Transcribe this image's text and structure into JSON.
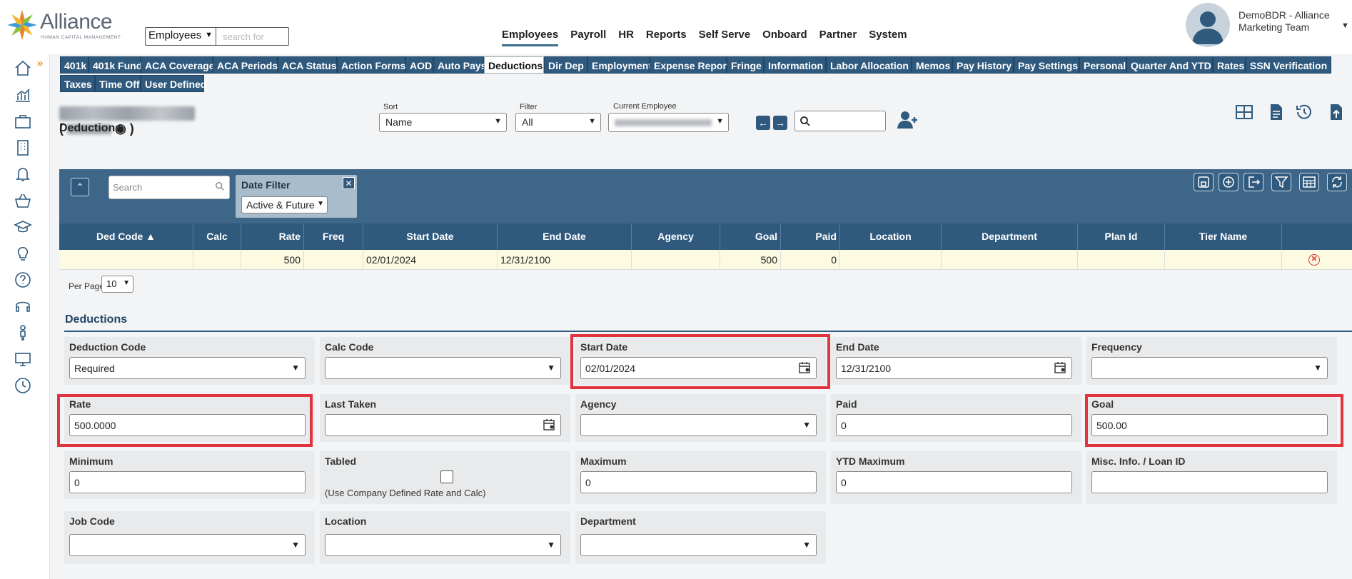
{
  "header": {
    "brand": "Alliance",
    "brand_tag": "HUMAN CAPITAL MANAGEMENT",
    "entity_select": "Employees",
    "search_placeholder": "search for",
    "nav": [
      "Employees",
      "Payroll",
      "HR",
      "Reports",
      "Self Serve",
      "Onboard",
      "Partner",
      "System"
    ],
    "active_nav": "Employees",
    "user_line1": "DemoBDR - Alliance",
    "user_line2": "Marketing Team"
  },
  "sidebar": {
    "icons": [
      "home-icon",
      "analytics-icon",
      "briefcase-icon",
      "building-icon",
      "bell-icon",
      "basket-icon",
      "graduation-cap-icon",
      "lightbulb-icon",
      "help-icon",
      "headset-icon",
      "person-icon",
      "monitor-icon",
      "clock-icon"
    ]
  },
  "tabs": {
    "row1": [
      "401k",
      "401k Fund",
      "ACA Coverage",
      "ACA Periods",
      "ACA Status",
      "Action Forms",
      "AOD",
      "Auto Pays",
      "Deductions",
      "Dir Dep",
      "Employment",
      "Expense Report",
      "Fringe",
      "Information",
      "Labor Allocation",
      "Memos",
      "Pay History",
      "Pay Settings",
      "Personal",
      "Quarter And YTD",
      "Rates",
      "SSN Verification"
    ],
    "row2": [
      "Taxes",
      "Time Off",
      "User Defined"
    ],
    "active": "Deductions"
  },
  "employee_bar": {
    "id_open": "(",
    "id_close": ")",
    "sort_label": "Sort",
    "sort_value": "Name",
    "filter_label": "Filter",
    "filter_value": "All",
    "current_label": "Current Employee"
  },
  "section_title": "Deductions",
  "grid": {
    "search_placeholder": "Search",
    "date_filter_label": "Date Filter",
    "date_filter_value": "Active & Future",
    "columns": [
      "Ded Code ▲",
      "Calc",
      "Rate",
      "Freq",
      "Start Date",
      "End Date",
      "Agency",
      "Goal",
      "Paid",
      "Location",
      "Department",
      "Plan Id",
      "Tier Name"
    ],
    "row": [
      "",
      "",
      "500",
      "",
      "02/01/2024",
      "12/31/2100",
      "",
      "500",
      "0",
      "",
      "",
      "",
      ""
    ],
    "per_page_label": "Per Page",
    "per_page_value": "10"
  },
  "form": {
    "title": "Deductions",
    "fields": {
      "deduction_code": {
        "label": "Deduction Code",
        "value": "Required"
      },
      "calc_code": {
        "label": "Calc Code",
        "value": ""
      },
      "start_date": {
        "label": "Start Date",
        "value": "02/01/2024"
      },
      "end_date": {
        "label": "End Date",
        "value": "12/31/2100"
      },
      "frequency": {
        "label": "Frequency",
        "value": ""
      },
      "rate": {
        "label": "Rate",
        "value": "500.0000"
      },
      "last_taken": {
        "label": "Last Taken",
        "value": ""
      },
      "agency": {
        "label": "Agency",
        "value": ""
      },
      "paid": {
        "label": "Paid",
        "value": "0"
      },
      "goal": {
        "label": "Goal",
        "value": "500.00"
      },
      "minimum": {
        "label": "Minimum",
        "value": "0"
      },
      "tabled": {
        "label": "Tabled",
        "note": "(Use Company Defined Rate and Calc)"
      },
      "maximum": {
        "label": "Maximum",
        "value": "0"
      },
      "ytd_maximum": {
        "label": "YTD Maximum",
        "value": "0"
      },
      "misc_info": {
        "label": "Misc. Info. / Loan ID",
        "value": ""
      },
      "job_code": {
        "label": "Job Code",
        "value": ""
      },
      "location": {
        "label": "Location",
        "value": ""
      },
      "department": {
        "label": "Department",
        "value": ""
      }
    }
  },
  "colors": {
    "primary": "#2f5a7e",
    "highlight": "#e0343f",
    "accent": "#f28c1c"
  }
}
